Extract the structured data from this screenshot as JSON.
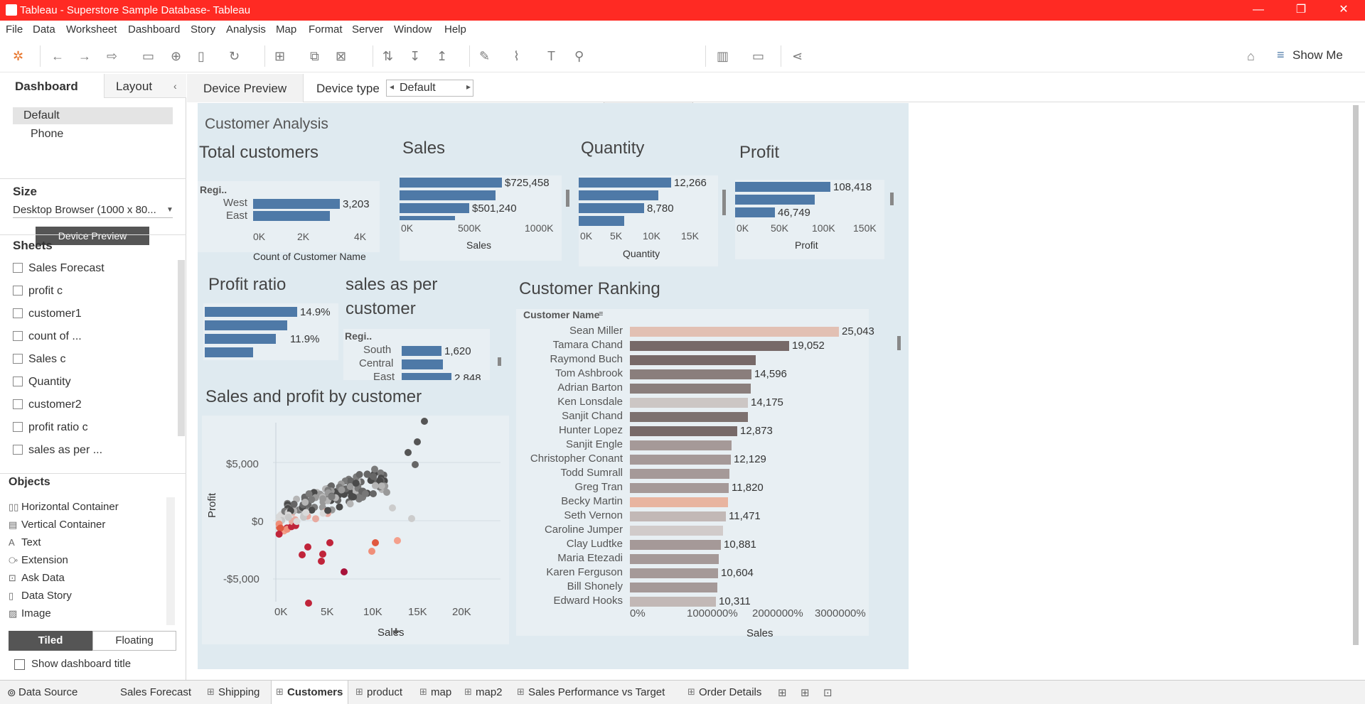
{
  "window": {
    "title": "Tableau - Superstore Sample Database- Tableau"
  },
  "menu": [
    "File",
    "Data",
    "Worksheet",
    "Dashboard",
    "Story",
    "Analysis",
    "Map",
    "Format",
    "Server",
    "Window",
    "Help"
  ],
  "toolbar": {
    "show_me": "Show Me"
  },
  "left_panel": {
    "tab_dashboard": "Dashboard",
    "tab_layout": "Layout",
    "device_default": "Default",
    "device_phone": "Phone",
    "device_preview_btn": "Device Preview",
    "size_heading": "Size",
    "size_value": "Desktop Browser (1000 x 80...",
    "sheets_heading": "Sheets",
    "sheets": [
      "Sales Forecast",
      "profit c",
      "customer1",
      "count of ...",
      "Sales c",
      "Quantity",
      "customer2",
      "profit ratio c",
      "sales as per ..."
    ],
    "objects_heading": "Objects",
    "objects": [
      "Horizontal Container",
      "Vertical Container",
      "Text",
      "Extension",
      "Ask Data",
      "Data Story",
      "Image"
    ],
    "tiled": "Tiled",
    "floating": "Floating",
    "show_title": "Show dashboard title"
  },
  "topbar": {
    "device_preview": "Device Preview",
    "device_type_label": "Device type",
    "device_type_value": "Default"
  },
  "dashboard": {
    "title": "Customer Analysis",
    "total_customers": {
      "title": "Total customers",
      "region_header": "Regi..",
      "rows": [
        "West",
        "East"
      ],
      "values": [
        "3,203"
      ],
      "ticks": [
        "0K",
        "2K",
        "4K"
      ],
      "xlabel": "Count of Customer Name"
    },
    "sales": {
      "title": "Sales",
      "values": [
        "$725,458",
        "$501,240"
      ],
      "ticks": [
        "0K",
        "500K",
        "1000K"
      ],
      "xlabel": "Sales"
    },
    "quantity": {
      "title": "Quantity",
      "values": [
        "12,266",
        "8,780"
      ],
      "ticks": [
        "0K",
        "5K",
        "10K",
        "15K"
      ],
      "xlabel": "Quantity"
    },
    "profit": {
      "title": "Profit",
      "values": [
        "108,418",
        "46,749"
      ],
      "ticks": [
        "0K",
        "50K",
        "100K",
        "150K"
      ],
      "xlabel": "Profit"
    },
    "profit_ratio": {
      "title": "Profit ratio",
      "values": [
        "14.9%",
        "11.9%"
      ]
    },
    "sales_per_customer": {
      "title_line1": "sales as per",
      "title_line2": "customer",
      "region_header": "Regi..",
      "rows": [
        "South",
        "Central",
        "East"
      ],
      "values": [
        "1,620",
        "2,848"
      ]
    },
    "scatter": {
      "title": "Sales and profit by customer",
      "yticks": [
        "$5,000",
        "$0",
        "-$5,000"
      ],
      "xticks": [
        "0K",
        "5K",
        "10K",
        "15K",
        "20K"
      ],
      "xlabel": "Sales",
      "ylabel": "Profit"
    },
    "ranking": {
      "title": "Customer Ranking",
      "header": "Customer Name",
      "ticks": [
        "0%",
        "1000000%",
        "2000000%",
        "3000000%"
      ],
      "xlabel": "Sales",
      "customers": [
        {
          "name": "Sean Miller",
          "value": "25,043",
          "color": "#e2c0b3"
        },
        {
          "name": "Tamara Chand",
          "value": "19,052",
          "color": "#776968"
        },
        {
          "name": "Raymond Buch",
          "value": "",
          "color": "#776968"
        },
        {
          "name": "Tom Ashbrook",
          "value": "14,596",
          "color": "#8a7e7c"
        },
        {
          "name": "Adrian Barton",
          "value": "",
          "color": "#8a7e7c"
        },
        {
          "name": "Ken Lonsdale",
          "value": "14,175",
          "color": "#ccc6c4"
        },
        {
          "name": "Sanjit Chand",
          "value": "",
          "color": "#7d716f"
        },
        {
          "name": "Hunter Lopez",
          "value": "12,873",
          "color": "#776968"
        },
        {
          "name": "Sanjit Engle",
          "value": "",
          "color": "#a59998"
        },
        {
          "name": "Christopher Conant",
          "value": "12,129",
          "color": "#a59998"
        },
        {
          "name": "Todd Sumrall",
          "value": "",
          "color": "#a59998"
        },
        {
          "name": "Greg Tran",
          "value": "11,820",
          "color": "#a59998"
        },
        {
          "name": "Becky Martin",
          "value": "",
          "color": "#e8b4a0"
        },
        {
          "name": "Seth Vernon",
          "value": "11,471",
          "color": "#c2b8b6"
        },
        {
          "name": "Caroline Jumper",
          "value": "",
          "color": "#d1cbca"
        },
        {
          "name": "Clay Ludtke",
          "value": "10,881",
          "color": "#a59998"
        },
        {
          "name": "Maria Etezadi",
          "value": "",
          "color": "#a59998"
        },
        {
          "name": "Karen Ferguson",
          "value": "10,604",
          "color": "#a59998"
        },
        {
          "name": "Bill Shonely",
          "value": "",
          "color": "#a59998"
        },
        {
          "name": "Edward Hooks",
          "value": "10,311",
          "color": "#c2b8b6"
        }
      ]
    }
  },
  "bottom_tabs": [
    "Data Source",
    "Sales Forecast",
    "Shipping",
    "Customers",
    "product",
    "map",
    "map2",
    "Sales Performance vs Target",
    "Order Details"
  ],
  "chart_data": [
    {
      "type": "bar",
      "title": "Customer Ranking",
      "categories": [
        "Sean Miller",
        "Tamara Chand",
        "Raymond Buch",
        "Tom Ashbrook",
        "Adrian Barton",
        "Ken Lonsdale",
        "Sanjit Chand",
        "Hunter Lopez",
        "Sanjit Engle",
        "Christopher Conant",
        "Todd Sumrall",
        "Greg Tran",
        "Becky Martin",
        "Seth Vernon",
        "Caroline Jumper",
        "Clay Ludtke",
        "Maria Etezadi",
        "Karen Ferguson",
        "Bill Shonely",
        "Edward Hooks"
      ],
      "values": [
        25043,
        19052,
        15117,
        14596,
        14474,
        14175,
        14142,
        12873,
        12210,
        12129,
        11892,
        11820,
        11790,
        11471,
        11164,
        10881,
        10664,
        10604,
        10502,
        10311
      ],
      "xlabel": "Sales",
      "ylabel": "Customer Name"
    },
    {
      "type": "bar",
      "title": "Total customers",
      "categories": [
        "West",
        "East"
      ],
      "values": [
        3203,
        2800
      ],
      "xlabel": "Count of Customer Name"
    }
  ]
}
